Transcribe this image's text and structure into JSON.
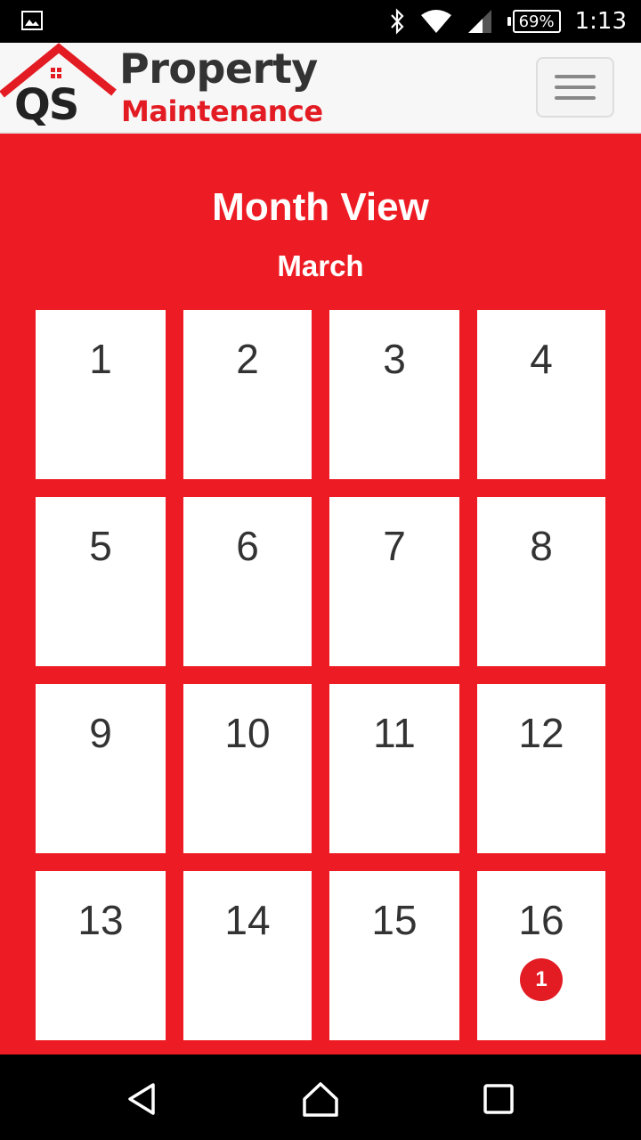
{
  "status_bar": {
    "battery": "69%",
    "time": "1:13",
    "icons": [
      "image-notification-icon",
      "bluetooth-icon",
      "wifi-icon",
      "signal-icon",
      "battery-icon"
    ]
  },
  "app_bar": {
    "logo": {
      "qs": "QS",
      "line1": "Property",
      "line2": "Maintenance"
    },
    "menu_icon": "hamburger-menu-icon"
  },
  "main": {
    "title": "Month View",
    "month": "March",
    "days": [
      {
        "day": "1"
      },
      {
        "day": "2"
      },
      {
        "day": "3"
      },
      {
        "day": "4"
      },
      {
        "day": "5"
      },
      {
        "day": "6"
      },
      {
        "day": "7"
      },
      {
        "day": "8"
      },
      {
        "day": "9"
      },
      {
        "day": "10"
      },
      {
        "day": "11"
      },
      {
        "day": "12"
      },
      {
        "day": "13"
      },
      {
        "day": "14"
      },
      {
        "day": "15"
      },
      {
        "day": "16",
        "badge": "1"
      }
    ]
  },
  "colors": {
    "primary_red": "#ed1c24",
    "badge_red": "#e31b23",
    "logo_dark": "#333333"
  },
  "nav_bar": {
    "icons": [
      "back-icon",
      "home-icon",
      "recents-icon"
    ]
  }
}
